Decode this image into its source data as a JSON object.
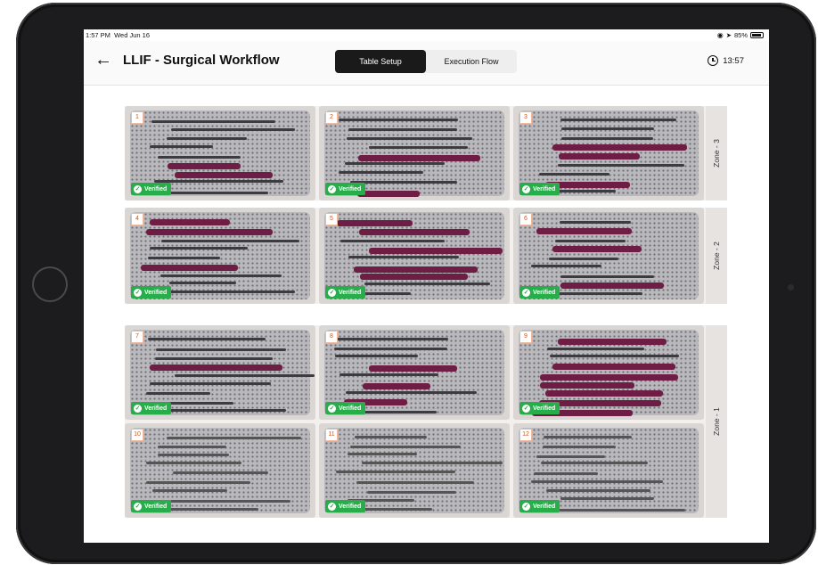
{
  "status_bar": {
    "time": "1:57 PM",
    "date": "Wed Jun 16",
    "battery": "85%",
    "wifi_icon": "wifi-icon",
    "signal_icon": "location-icon"
  },
  "app_bar": {
    "back_icon": "arrow-left-icon",
    "title": "LLIF - Surgical Workflow",
    "tabs": [
      {
        "label": "Table Setup",
        "active": true
      },
      {
        "label": "Execution Flow",
        "active": false
      }
    ],
    "timer": "13:57",
    "timer_icon": "clock-icon"
  },
  "zones": [
    {
      "label": "Zone - 3",
      "trays": [
        {
          "number": "1",
          "status": "Verified"
        },
        {
          "number": "2",
          "status": "Verified"
        },
        {
          "number": "3",
          "status": "Verified"
        }
      ]
    },
    {
      "label": "Zone - 2",
      "trays": [
        {
          "number": "4",
          "status": "Verified"
        },
        {
          "number": "5",
          "status": "Verified"
        },
        {
          "number": "6",
          "status": "Verified"
        }
      ]
    },
    {
      "label": "Zone - 1",
      "trays": [
        {
          "number": "7",
          "status": "Verified"
        },
        {
          "number": "8",
          "status": "Verified"
        },
        {
          "number": "9",
          "status": "Verified"
        },
        {
          "number": "10",
          "status": "Verified"
        },
        {
          "number": "11",
          "status": "Verified"
        },
        {
          "number": "12",
          "status": "Verified"
        }
      ]
    }
  ],
  "colors": {
    "verified": "#27ae4a",
    "number_border": "#f0b89d",
    "active_tab": "#1a1a1a",
    "instrument_purple": "#6e1d45"
  }
}
